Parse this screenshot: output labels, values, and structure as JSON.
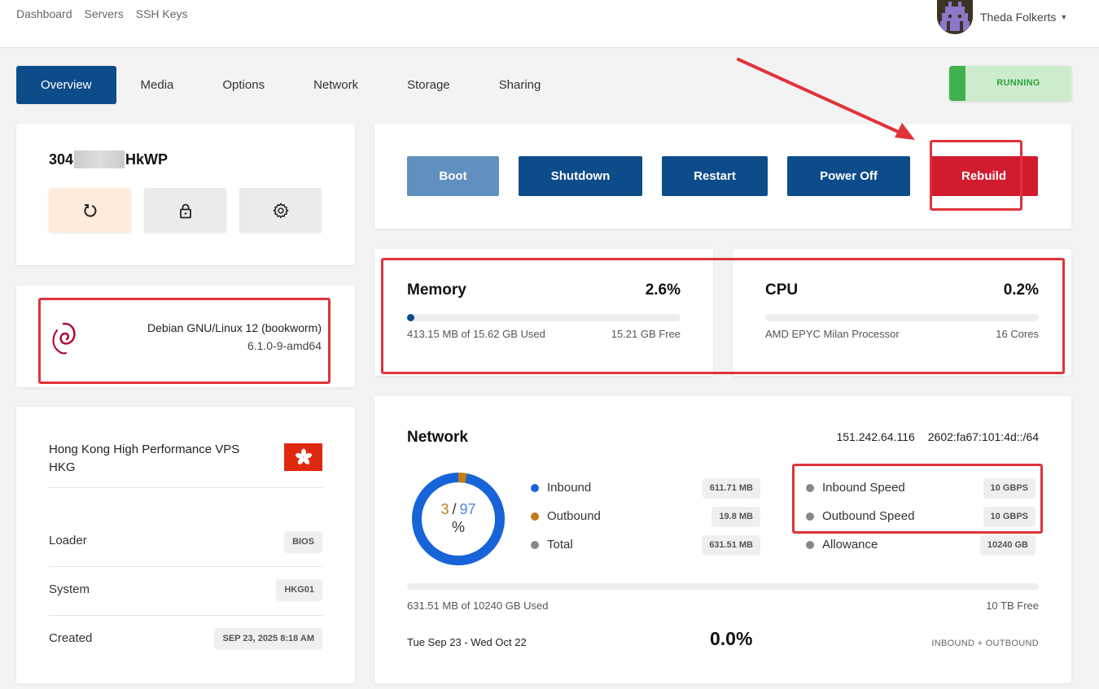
{
  "nav": {
    "links": [
      "Dashboard",
      "Servers",
      "SSH Keys"
    ],
    "user": "Theda Folkerts"
  },
  "tabs": [
    "Overview",
    "Media",
    "Options",
    "Network",
    "Storage",
    "Sharing"
  ],
  "status": "RUNNING",
  "server": {
    "name_prefix": "304",
    "name_suffix": "HkWP"
  },
  "os": {
    "name": "Debian GNU/Linux 12 (bookworm)",
    "kernel": "6.1.0-9-amd64"
  },
  "location": {
    "name": "Hong Kong High Performance VPS HKG",
    "loader_label": "Loader",
    "loader": "BIOS",
    "system_label": "System",
    "system": "HKG01",
    "created_label": "Created",
    "created": "SEP 23, 2025 8:18 AM"
  },
  "power": {
    "boot": "Boot",
    "shutdown": "Shutdown",
    "restart": "Restart",
    "poweroff": "Power Off",
    "rebuild": "Rebuild"
  },
  "memory": {
    "title": "Memory",
    "value": "2.6%",
    "used": "413.15 MB of 15.62 GB Used",
    "free": "15.21 GB Free",
    "fraction": 0.026
  },
  "cpu": {
    "title": "CPU",
    "value": "0.2%",
    "model": "AMD EPYC Milan Processor",
    "cores": "16 Cores",
    "fraction": 0.002
  },
  "network": {
    "title": "Network",
    "ipv4": "151.242.64.116",
    "ipv6": "2602:fa67:101:4d::/64",
    "donut": {
      "out": "3",
      "sep": "/",
      "in": "97",
      "unit": "%",
      "out_fraction": 0.03
    },
    "inbound_label": "Inbound",
    "inbound": "611.71 MB",
    "outbound_label": "Outbound",
    "outbound": "19.8 MB",
    "total_label": "Total",
    "total": "631.51 MB",
    "inbound_speed_label": "Inbound Speed",
    "inbound_speed": "10 GBPS",
    "outbound_speed_label": "Outbound Speed",
    "outbound_speed": "10 GBPS",
    "allowance_label": "Allowance",
    "allowance": "10240 GB",
    "used": "631.51 MB of 10240 GB Used",
    "free": "10 TB Free",
    "period": "Tue Sep 23 - Wed Oct 22",
    "percent": "0.0%",
    "scope": "INBOUND + OUTBOUND"
  },
  "colors": {
    "primary": "#0d4c8b",
    "boot": "#6090bf",
    "rebuild": "#d21b2f",
    "annotation": "#e0333a",
    "inbound": "#1764d8",
    "outbound": "#c07c15",
    "running": "#29a33c"
  }
}
